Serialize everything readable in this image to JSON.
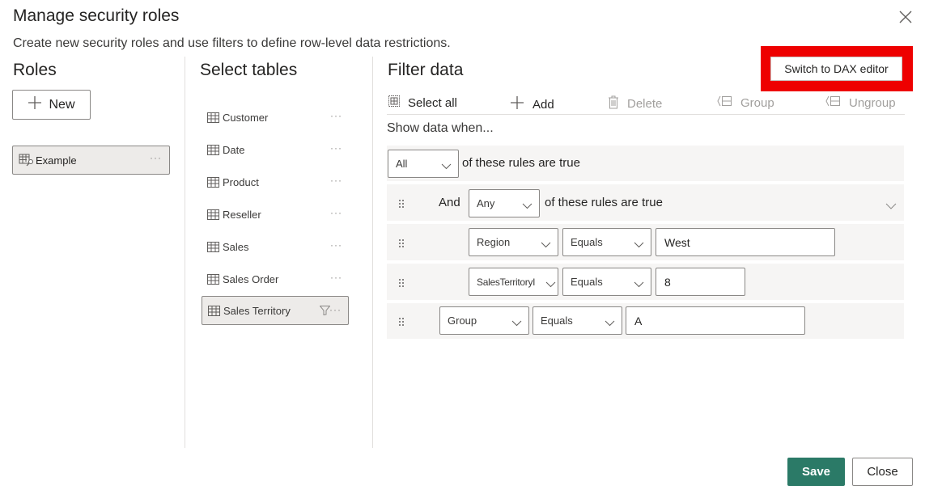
{
  "dialog": {
    "title": "Manage security roles",
    "subtitle": "Create new security roles and use filters to define row-level data restrictions.",
    "close_icon": "close-icon"
  },
  "roles": {
    "heading": "Roles",
    "new_label": "New",
    "items": [
      {
        "label": "Example",
        "icon": "role-table-edit-icon",
        "selected": true
      }
    ]
  },
  "tables": {
    "heading": "Select tables",
    "items": [
      {
        "label": "Customer",
        "selected": false,
        "filtered": false
      },
      {
        "label": "Date",
        "selected": false,
        "filtered": false
      },
      {
        "label": "Product",
        "selected": false,
        "filtered": false
      },
      {
        "label": "Reseller",
        "selected": false,
        "filtered": false
      },
      {
        "label": "Sales",
        "selected": false,
        "filtered": false
      },
      {
        "label": "Sales Order",
        "selected": false,
        "filtered": false
      },
      {
        "label": "Sales Territory",
        "selected": true,
        "filtered": true
      }
    ],
    "more_label": "···"
  },
  "filter": {
    "heading": "Filter data",
    "dax_button": "Switch to DAX editor",
    "toolbar": {
      "select_all": "Select all",
      "add": "Add",
      "delete": "Delete",
      "group": "Group",
      "ungroup": "Ungroup"
    },
    "show_when": "Show data when...",
    "top_rule": {
      "quantifier": "All",
      "text": "of these rules are true"
    },
    "group_rule": {
      "conjunction": "And",
      "quantifier": "Any",
      "text": "of these rules are true"
    },
    "nested_rules": [
      {
        "column": "Region",
        "operator": "Equals",
        "value": "West"
      },
      {
        "column": "SalesTerritoryI",
        "operator": "Equals",
        "value": "8"
      }
    ],
    "rule": {
      "column": "Group",
      "operator": "Equals",
      "value": "A"
    }
  },
  "footer": {
    "save": "Save",
    "close": "Close"
  },
  "colors": {
    "primary": "#2b7a67",
    "highlight": "#ee0000",
    "selected_bg": "#edebe9",
    "row_bg": "#f6f5f4"
  }
}
